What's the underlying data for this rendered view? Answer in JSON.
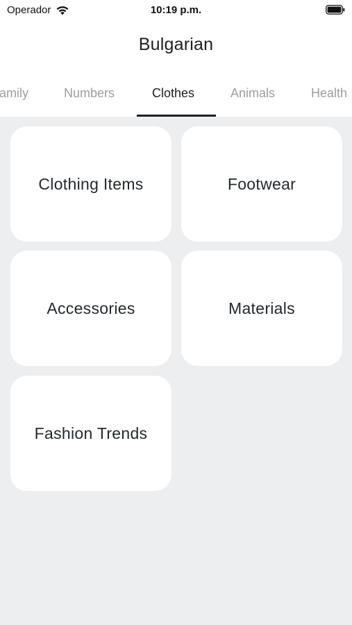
{
  "status_bar": {
    "carrier": "Operador",
    "time": "10:19 p.m."
  },
  "header": {
    "title": "Bulgarian"
  },
  "tabs": [
    {
      "label": "Family",
      "visible_text": "amily",
      "active": false
    },
    {
      "label": "Numbers",
      "active": false
    },
    {
      "label": "Clothes",
      "active": true
    },
    {
      "label": "Animals",
      "active": false
    },
    {
      "label": "Health",
      "visible_text": "Health",
      "active": false
    }
  ],
  "categories": [
    {
      "label": "Clothing Items"
    },
    {
      "label": "Footwear"
    },
    {
      "label": "Accessories"
    },
    {
      "label": "Materials"
    },
    {
      "label": "Fashion Trends"
    }
  ],
  "colors": {
    "background": "#edeef0",
    "card": "#ffffff",
    "text": "#1f262a",
    "inactive_tab": "#9a9ea1",
    "active_indicator": "#1a1f22"
  },
  "icons": [
    "wifi-icon",
    "battery-icon"
  ]
}
